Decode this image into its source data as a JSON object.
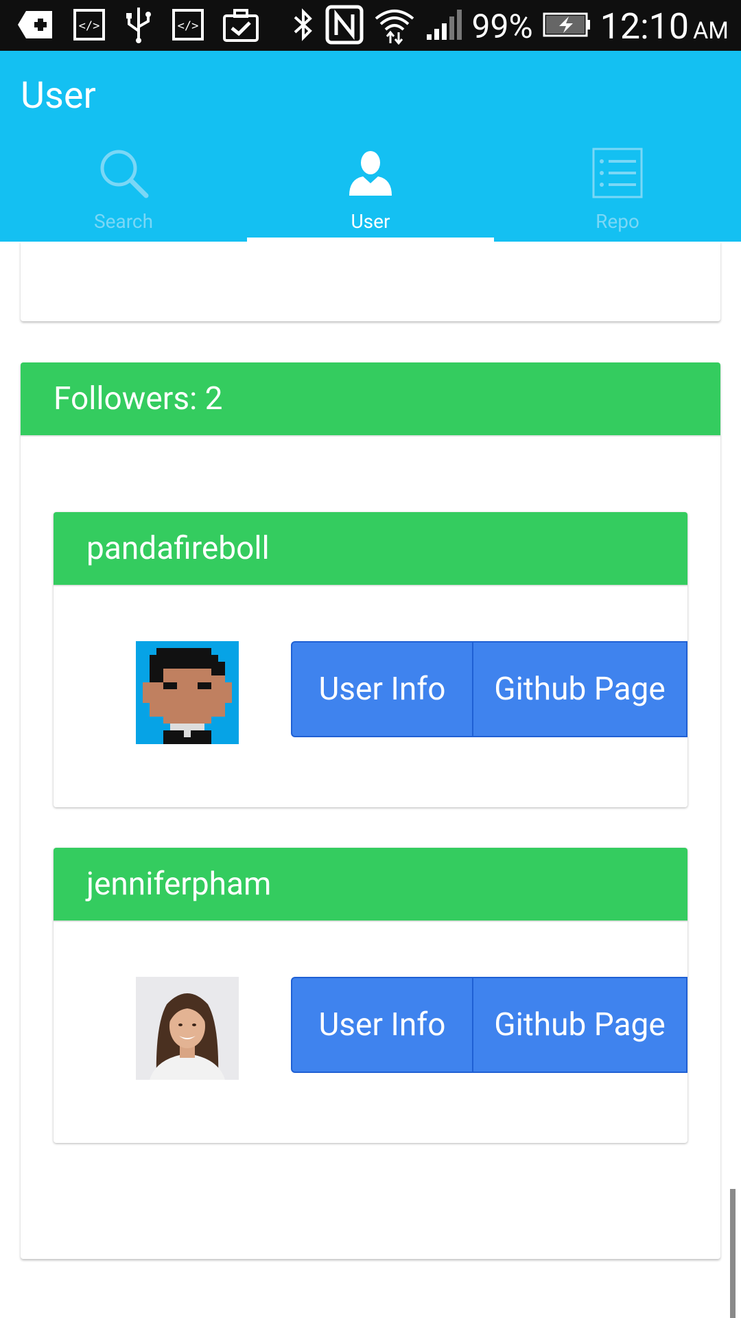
{
  "status_bar": {
    "battery": "99%",
    "time": "12:10",
    "ampm": "AM",
    "left_icons": [
      "add-icon",
      "code-icon",
      "usb-icon",
      "code-icon",
      "briefcase-check-icon"
    ],
    "right_icons": [
      "bluetooth-icon",
      "nfc-icon",
      "wifi-icon",
      "signal-icon",
      "battery-charging-icon"
    ]
  },
  "appbar": {
    "title": "User",
    "color": "#14c0f2"
  },
  "tabs": [
    {
      "label": "Search",
      "icon": "search-icon",
      "active": false
    },
    {
      "label": "User",
      "icon": "user-icon",
      "active": true
    },
    {
      "label": "Repo",
      "icon": "list-icon",
      "active": false
    }
  ],
  "followers": {
    "title": "Followers: 2",
    "header_color": "#34cc5f",
    "users": [
      {
        "name": "pandafireboll",
        "avatar": "pixel-avatar",
        "info_label": "User Info",
        "github_label": "Github Page"
      },
      {
        "name": "jenniferpham",
        "avatar": "photo-avatar",
        "info_label": "User Info",
        "github_label": "Github Page"
      }
    ]
  },
  "colors": {
    "button": "#3f83ee",
    "button_border": "#1f60d4"
  }
}
